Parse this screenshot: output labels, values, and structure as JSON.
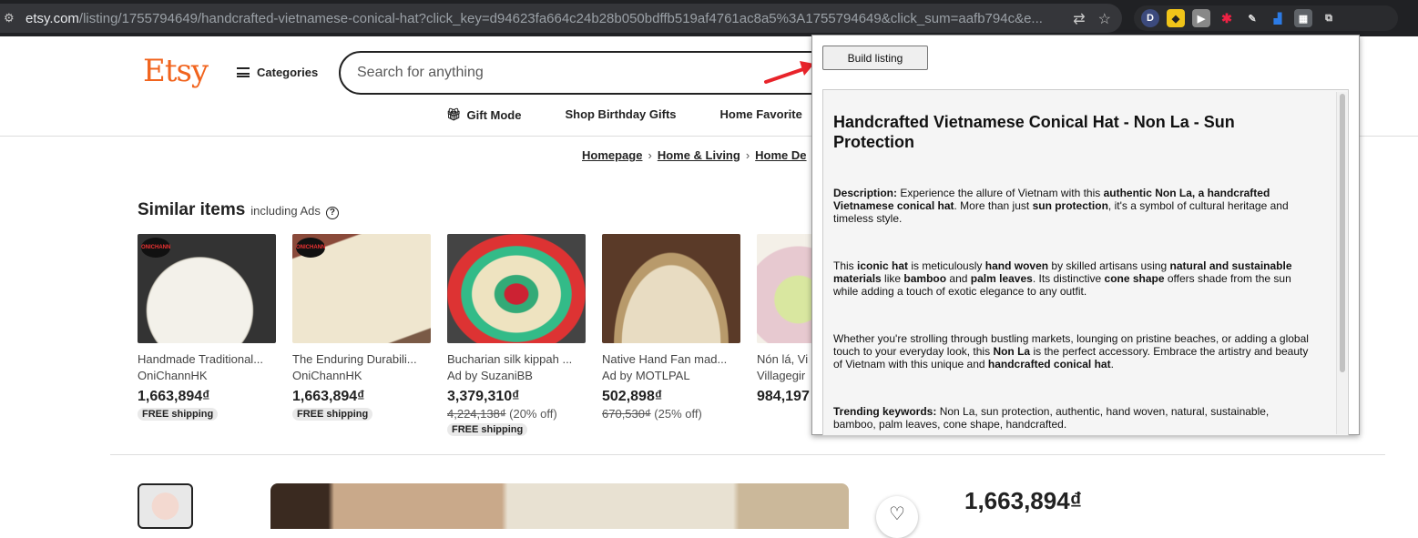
{
  "browser": {
    "url_main": "etsy.com",
    "url_path": "/listing/1755794649/handcrafted-vietnamese-conical-hat?click_key=d94623fa664c24b28b050bdffb519af4761ac8a5%3A1755794649&click_sum=aafb794c&e..."
  },
  "header": {
    "logo": "Etsy",
    "categories_label": "Categories",
    "search_placeholder": "Search for anything",
    "subnav": [
      "Gift Mode",
      "Shop Birthday Gifts",
      "Home Favorite"
    ]
  },
  "breadcrumb": [
    "Homepage",
    "Home & Living",
    "Home De"
  ],
  "similar": {
    "title": "Similar items",
    "subtitle": "including Ads",
    "items": [
      {
        "title": "Handmade Traditional...",
        "shop": "OniChannHK",
        "price": "1,663,894₫",
        "orig": "",
        "discount": "",
        "badge": "FREE shipping"
      },
      {
        "title": "The Enduring Durabili...",
        "shop": "OniChannHK",
        "price": "1,663,894₫",
        "orig": "",
        "discount": "",
        "badge": "FREE shipping"
      },
      {
        "title": "Bucharian silk kippah ...",
        "shop": "Ad by SuzaniBB",
        "price": "3,379,310₫",
        "orig": "4,224,138₫",
        "discount": "(20% off)",
        "badge": "FREE shipping"
      },
      {
        "title": "Native Hand Fan mad...",
        "shop": "Ad by MOTLPAL",
        "price": "502,898₫",
        "orig": "670,530₫",
        "discount": "(25% off)",
        "badge": ""
      },
      {
        "title": "Nón lá, Vi",
        "shop": "Villagegir",
        "price": "984,197",
        "orig": "",
        "discount": "",
        "badge": ""
      }
    ]
  },
  "listing": {
    "price": "1,663,894₫"
  },
  "popup": {
    "button_label": "Build listing",
    "heading": "Handcrafted Vietnamese Conical Hat - Non La - Sun Protection",
    "desc_label": "Description:",
    "p1_a": " Experience the allure of Vietnam with this ",
    "p1_b": "authentic Non La, a handcrafted Vietnamese conical hat",
    "p1_c": ". More than just ",
    "p1_d": "sun protection",
    "p1_e": ", it's a symbol of cultural heritage and timeless style.",
    "p2_a": "This ",
    "p2_b": "iconic hat",
    "p2_c": " is meticulously ",
    "p2_d": "hand woven",
    "p2_e": " by skilled artisans using ",
    "p2_f": "natural and sustainable materials",
    "p2_g": " like ",
    "p2_h": "bamboo",
    "p2_i": " and ",
    "p2_j": "palm leaves",
    "p2_k": ". Its distinctive ",
    "p2_l": "cone shape",
    "p2_m": " offers shade from the sun while adding a touch of exotic elegance to any outfit.",
    "p3_a": "Whether you're strolling through bustling markets, lounging on pristine beaches, or adding a global touch to your everyday look, this ",
    "p3_b": "Non La",
    "p3_c": " is the perfect accessory. Embrace the artistry and beauty of Vietnam with this unique and ",
    "p3_d": "handcrafted conical hat",
    "p3_e": ".",
    "kw_label": "Trending keywords:",
    "kw_text": " Non La, sun protection, authentic, hand woven, natural, sustainable, bamboo, palm leaves, cone shape, handcrafted."
  },
  "colors": {
    "etsy_orange": "#f1641e",
    "arrow_red": "#e8232a"
  }
}
